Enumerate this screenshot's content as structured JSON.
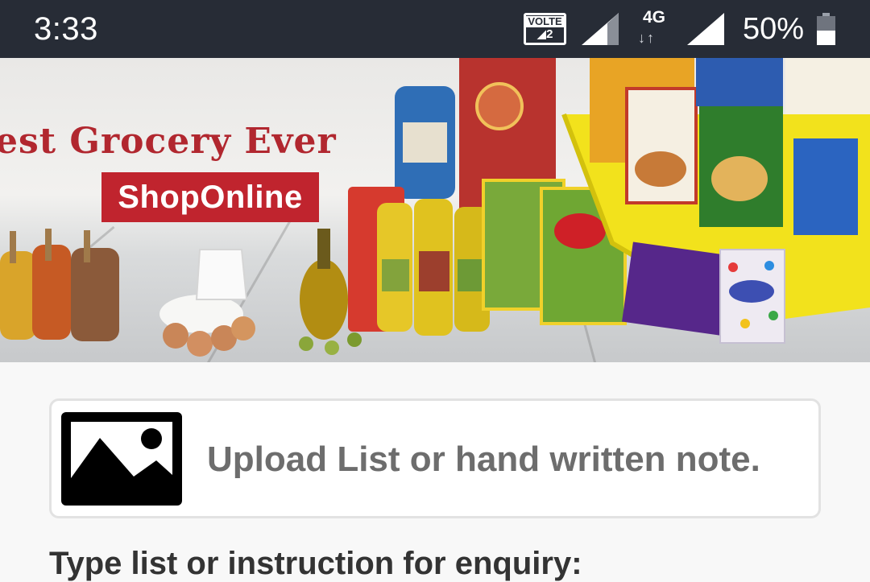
{
  "status_bar": {
    "time": "3:33",
    "volte": "VOLTE",
    "sim_slot": "2",
    "network_type": "4G",
    "network_arrows": "↓↑",
    "battery_percent": "50%",
    "battery_level": 0.5,
    "background": "#272c36"
  },
  "banner": {
    "title": "est Grocery Ever",
    "badge": "ShopOnline",
    "accent": "#c0242e"
  },
  "upload": {
    "icon": "image-icon",
    "label": "Upload List or hand written note."
  },
  "instructions": {
    "label": "Type list or instruction for enquiry:"
  }
}
